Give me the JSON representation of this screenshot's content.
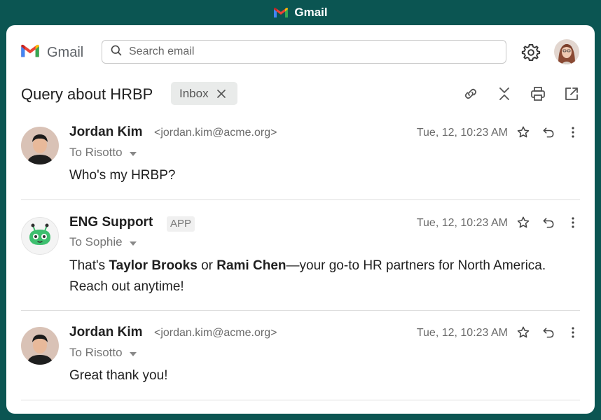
{
  "window": {
    "title": "Gmail"
  },
  "header": {
    "brand": "Gmail",
    "search_placeholder": "Search email"
  },
  "thread": {
    "subject": "Query about HRBP",
    "label_chip": "Inbox"
  },
  "messages": [
    {
      "sender": "Jordan Kim",
      "email": "<jordan.kim@acme.org>",
      "to": "To Risotto",
      "time": "Tue, 12, 10:23 AM",
      "body": "Who's my HRBP?"
    },
    {
      "sender": "ENG Support",
      "badge": "APP",
      "to": "To Sophie",
      "time": "Tue, 12, 10:23 AM",
      "body_parts": [
        "That's ",
        "Taylor Brooks",
        " or ",
        "Rami Chen",
        "—your go-to HR partners for North America. Reach out anytime!"
      ]
    },
    {
      "sender": "Jordan Kim",
      "email": "<jordan.kim@acme.org>",
      "to": "To Risotto",
      "time": "Tue, 12, 10:23 AM",
      "body": "Great thank you!"
    }
  ],
  "colors": {
    "frame_bg": "#0b5552",
    "bot_green": "#3dbf6e",
    "text": "#1f1f1f",
    "muted": "#6b6b6b"
  },
  "icons": [
    "gmail-logo-icon",
    "search-icon",
    "gear-icon",
    "close-icon",
    "link-icon",
    "collapse-icon",
    "print-icon",
    "open-external-icon",
    "star-icon",
    "reply-icon",
    "more-vertical-icon",
    "chevron-down-icon"
  ]
}
